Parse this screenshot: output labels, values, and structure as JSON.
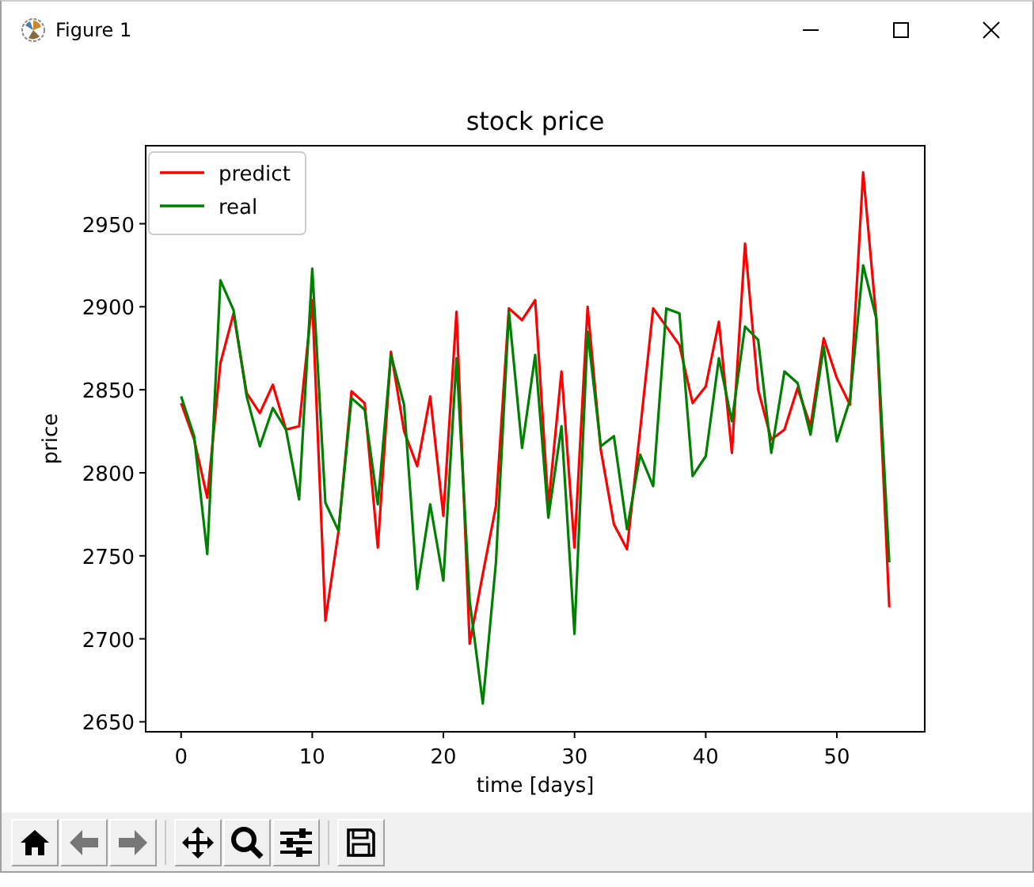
{
  "window": {
    "title": "Figure 1"
  },
  "figure": {
    "chart_data": {
      "type": "line",
      "title": "stock price",
      "xlabel": "time [days]",
      "ylabel": "price",
      "x": [
        0,
        1,
        2,
        3,
        4,
        5,
        6,
        7,
        8,
        9,
        10,
        11,
        12,
        13,
        14,
        15,
        16,
        17,
        18,
        19,
        20,
        21,
        22,
        23,
        24,
        25,
        26,
        27,
        28,
        29,
        30,
        31,
        32,
        33,
        34,
        35,
        36,
        37,
        38,
        39,
        40,
        41,
        42,
        43,
        44,
        45,
        46,
        47,
        48,
        49,
        50,
        51,
        52,
        53,
        54
      ],
      "series": [
        {
          "name": "predict",
          "color": "#ff0000",
          "values": [
            2842,
            2820,
            2785,
            2866,
            2896,
            2848,
            2836,
            2853,
            2826,
            2828,
            2904,
            2711,
            2765,
            2849,
            2842,
            2755,
            2873,
            2825,
            2804,
            2846,
            2774,
            2897,
            2697,
            2739,
            2780,
            2899,
            2892,
            2904,
            2780,
            2861,
            2755,
            2900,
            2814,
            2769,
            2754,
            2826,
            2899,
            2888,
            2877,
            2842,
            2852,
            2891,
            2812,
            2938,
            2850,
            2820,
            2826,
            2851,
            2828,
            2881,
            2857,
            2841,
            2981,
            2893,
            2719
          ]
        },
        {
          "name": "real",
          "color": "#008000",
          "values": [
            2846,
            2822,
            2751,
            2916,
            2898,
            2846,
            2816,
            2839,
            2826,
            2784,
            2923,
            2782,
            2765,
            2845,
            2838,
            2781,
            2871,
            2841,
            2730,
            2781,
            2735,
            2869,
            2723,
            2661,
            2746,
            2897,
            2815,
            2871,
            2773,
            2828,
            2703,
            2885,
            2816,
            2822,
            2766,
            2811,
            2792,
            2899,
            2896,
            2798,
            2810,
            2869,
            2831,
            2888,
            2880,
            2812,
            2861,
            2854,
            2823,
            2876,
            2819,
            2844,
            2925,
            2893,
            2746
          ]
        }
      ],
      "legend": true,
      "xlim": [
        -2.7,
        56.7
      ],
      "ylim": [
        2644,
        2997
      ],
      "xticks": [
        0,
        10,
        20,
        30,
        40,
        50
      ],
      "yticks": [
        2650,
        2700,
        2750,
        2800,
        2850,
        2900,
        2950
      ]
    }
  }
}
